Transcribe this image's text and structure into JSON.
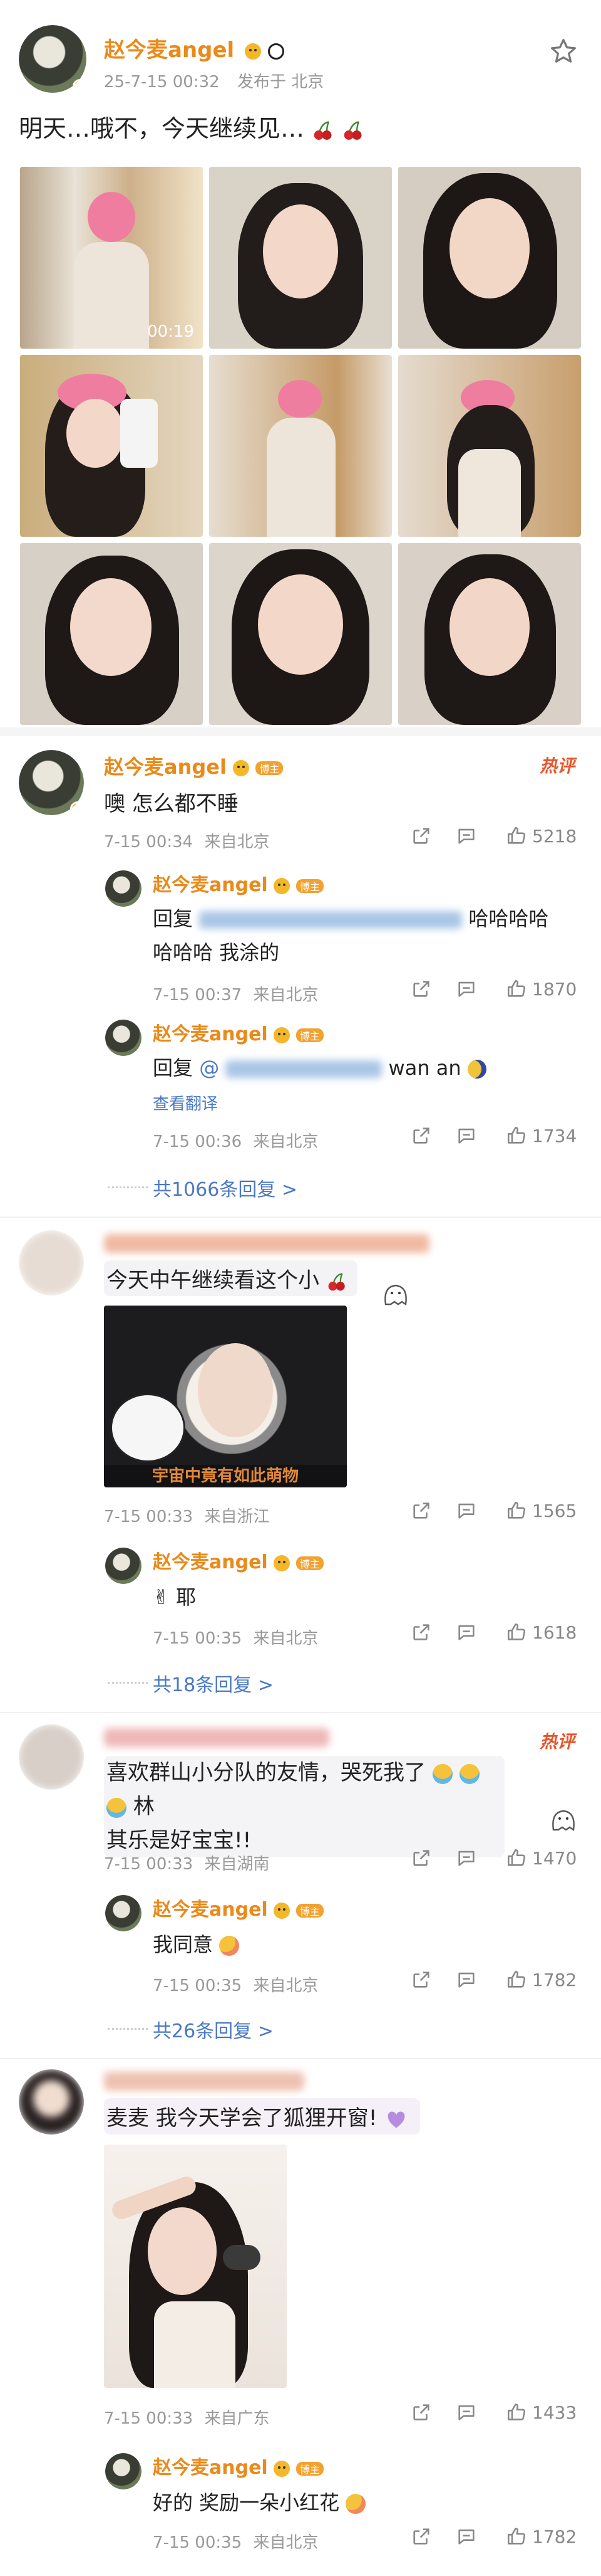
{
  "post": {
    "author": "赵今麦angel",
    "time": "25-7-15 00:32",
    "location": "发布于 北京",
    "text": "明天…哦不，今天继续见…",
    "video_duration": "00:19"
  },
  "comments": [
    {
      "author": "赵今麦angel",
      "badge": "博主",
      "hot": "热评",
      "text": "噢 怎么都不睡",
      "time": "7-15 00:34",
      "loc": "来自北京",
      "likes": "5218",
      "replies": [
        {
          "author": "赵今麦angel",
          "badge": "博主",
          "prefix": "回复",
          "suffix": "哈哈哈哈",
          "text2": "哈哈哈 我涂的",
          "time": "7-15 00:37",
          "loc": "来自北京",
          "likes": "1870"
        },
        {
          "author": "赵今麦angel",
          "badge": "博主",
          "prefix": "回复",
          "suffix": "wan an",
          "translate": "查看翻译",
          "time": "7-15 00:36",
          "loc": "来自北京",
          "likes": "1734"
        }
      ],
      "more": "共1066条回复 >"
    },
    {
      "text": "今天中午继续看这个小",
      "image_caption": "宇宙中竟有如此萌物",
      "time": "7-15 00:33",
      "loc": "来自浙江",
      "likes": "1565",
      "replies": [
        {
          "author": "赵今麦angel",
          "badge": "博主",
          "text": "✌ 耶",
          "time": "7-15 00:35",
          "loc": "来自北京",
          "likes": "1618"
        }
      ],
      "more": "共18条回复 >"
    },
    {
      "hot": "热评",
      "text": "喜欢群山小分队的友情，哭死我了",
      "text_b": "林",
      "text2": "其乐是好宝宝!!",
      "time": "7-15 00:33",
      "loc": "来自湖南",
      "likes": "1470",
      "replies": [
        {
          "author": "赵今麦angel",
          "badge": "博主",
          "text": "我同意",
          "time": "7-15 00:35",
          "loc": "来自北京",
          "likes": "1782"
        }
      ],
      "more": "共26条回复 >"
    },
    {
      "text": "麦麦 我今天学会了狐狸开窗!",
      "time": "7-15 00:33",
      "loc": "来自广东",
      "likes": "1433",
      "replies": [
        {
          "author": "赵今麦angel",
          "badge": "博主",
          "text": "好的 奖励一朵小红花",
          "time": "7-15 00:35",
          "loc": "来自北京",
          "likes": "1782"
        }
      ]
    }
  ]
}
